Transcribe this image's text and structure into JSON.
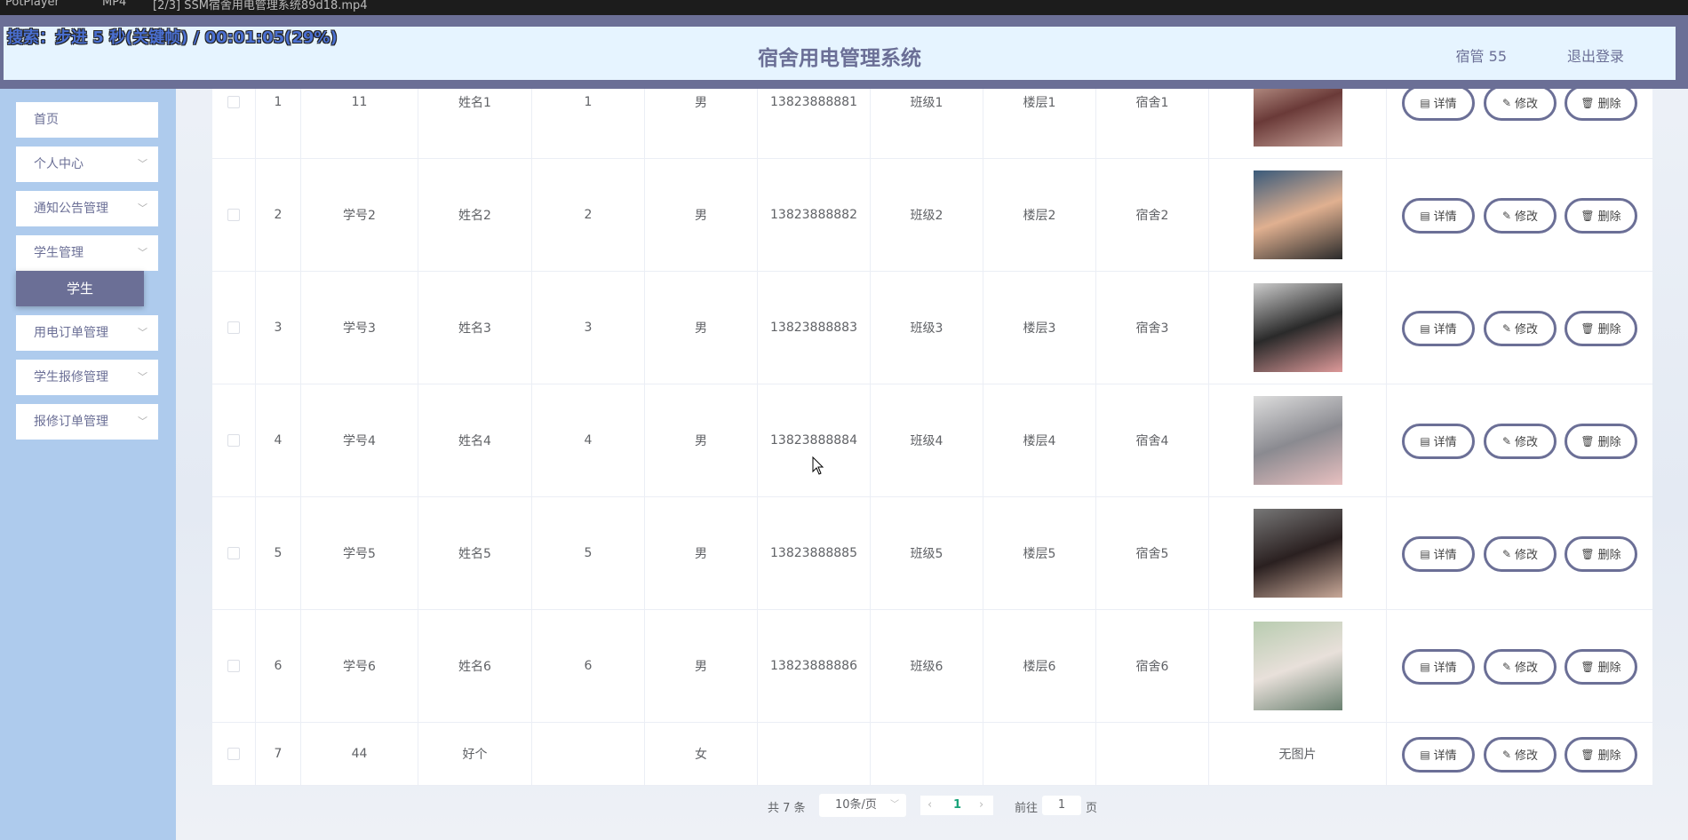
{
  "player": {
    "app": "PotPlayer",
    "format": "MP4",
    "file": "[2/3] SSM宿舍用电管理系统89d18.mp4",
    "osd": "搜索：步进 5 秒(关键帧) / 00:01:05(29%)"
  },
  "header": {
    "title": "宿舍用电管理系统",
    "user": "宿管 55",
    "logout": "退出登录"
  },
  "sidebar": {
    "items": [
      {
        "label": "首页"
      },
      {
        "label": "个人中心"
      },
      {
        "label": "通知公告管理"
      },
      {
        "label": "学生管理"
      },
      {
        "label": "用电订单管理"
      },
      {
        "label": "学生报修管理"
      },
      {
        "label": "报修订单管理"
      }
    ],
    "sub_active": "学生"
  },
  "table": {
    "rows": [
      {
        "idx": "1",
        "no": "11",
        "name": "姓名1",
        "c3": "1",
        "sex": "男",
        "phone": "13823888881",
        "cls": "班级1",
        "floor": "楼层1",
        "dorm": "宿舍1",
        "photo": true
      },
      {
        "idx": "2",
        "no": "学号2",
        "name": "姓名2",
        "c3": "2",
        "sex": "男",
        "phone": "13823888882",
        "cls": "班级2",
        "floor": "楼层2",
        "dorm": "宿舍2",
        "photo": true
      },
      {
        "idx": "3",
        "no": "学号3",
        "name": "姓名3",
        "c3": "3",
        "sex": "男",
        "phone": "13823888883",
        "cls": "班级3",
        "floor": "楼层3",
        "dorm": "宿舍3",
        "photo": true
      },
      {
        "idx": "4",
        "no": "学号4",
        "name": "姓名4",
        "c3": "4",
        "sex": "男",
        "phone": "13823888884",
        "cls": "班级4",
        "floor": "楼层4",
        "dorm": "宿舍4",
        "photo": true
      },
      {
        "idx": "5",
        "no": "学号5",
        "name": "姓名5",
        "c3": "5",
        "sex": "男",
        "phone": "13823888885",
        "cls": "班级5",
        "floor": "楼层5",
        "dorm": "宿舍5",
        "photo": true
      },
      {
        "idx": "6",
        "no": "学号6",
        "name": "姓名6",
        "c3": "6",
        "sex": "男",
        "phone": "13823888886",
        "cls": "班级6",
        "floor": "楼层6",
        "dorm": "宿舍6",
        "photo": true
      },
      {
        "idx": "7",
        "no": "44",
        "name": "好个",
        "c3": "",
        "sex": "女",
        "phone": "",
        "cls": "",
        "floor": "",
        "dorm": "",
        "photo": false
      }
    ],
    "no_image": "无图片",
    "actions": {
      "detail": "详情",
      "edit": "修改",
      "delete": "删除"
    }
  },
  "pagination": {
    "total": "共 7 条",
    "page_size": "10条/页",
    "current": "1",
    "goto_label": "前往",
    "goto_value": "1",
    "page_suffix": "页"
  },
  "colors": {
    "accent": "#6b6f96",
    "sidebar": "#aecbed",
    "header_bg": "#e6f4ff"
  }
}
